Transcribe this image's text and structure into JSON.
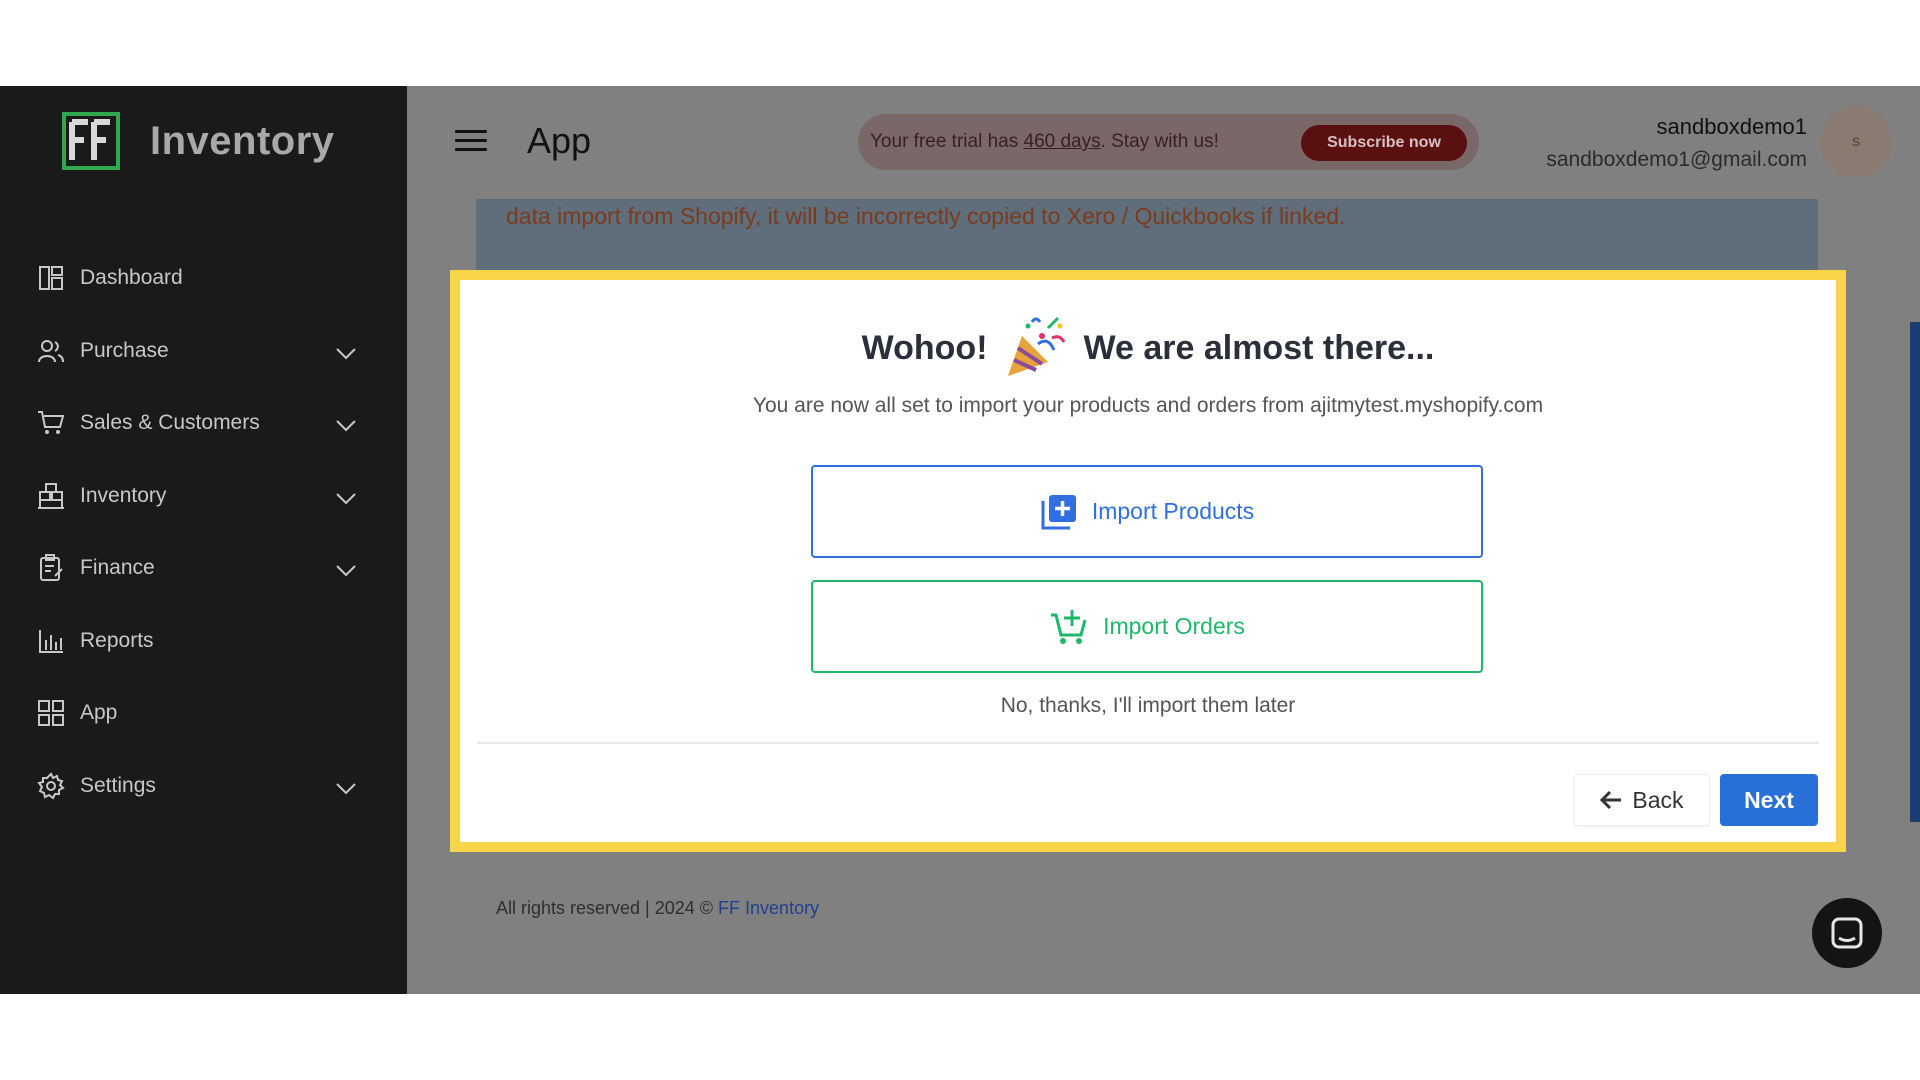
{
  "brand": {
    "name": "Inventory"
  },
  "sidebar": {
    "items": [
      {
        "label": "Dashboard"
      },
      {
        "label": "Purchase"
      },
      {
        "label": "Sales & Customers"
      },
      {
        "label": "Inventory"
      },
      {
        "label": "Finance"
      },
      {
        "label": "Reports"
      },
      {
        "label": "App"
      },
      {
        "label": "Settings"
      }
    ]
  },
  "header": {
    "title": "App",
    "trial_prefix": "Your free trial has ",
    "trial_days": "460 days",
    "trial_suffix": ". Stay with us!",
    "subscribe_label": "Subscribe now",
    "user_name": "sandboxdemo1",
    "user_email": "sandboxdemo1@gmail.com",
    "avatar_initial": "s"
  },
  "banner": {
    "text": "data import from Shopify, it will be incorrectly copied to Xero / Quickbooks if linked."
  },
  "modal": {
    "title_left": "Wohoo!",
    "title_right": "We are almost there...",
    "subtitle": "You are now all set to import your products and orders from ajitmytest.myshopify.com",
    "import_products_label": "Import Products",
    "import_orders_label": "Import Orders",
    "skip_label": "No, thanks, I'll import them later",
    "back_label": "Back",
    "next_label": "Next"
  },
  "footer": {
    "text": "All rights reserved | 2024 © ",
    "link": "FF Inventory"
  },
  "colors": {
    "primary": "#2870d8",
    "success": "#1fb86a",
    "highlight": "#f8d548",
    "subscribe": "#5a1010"
  }
}
